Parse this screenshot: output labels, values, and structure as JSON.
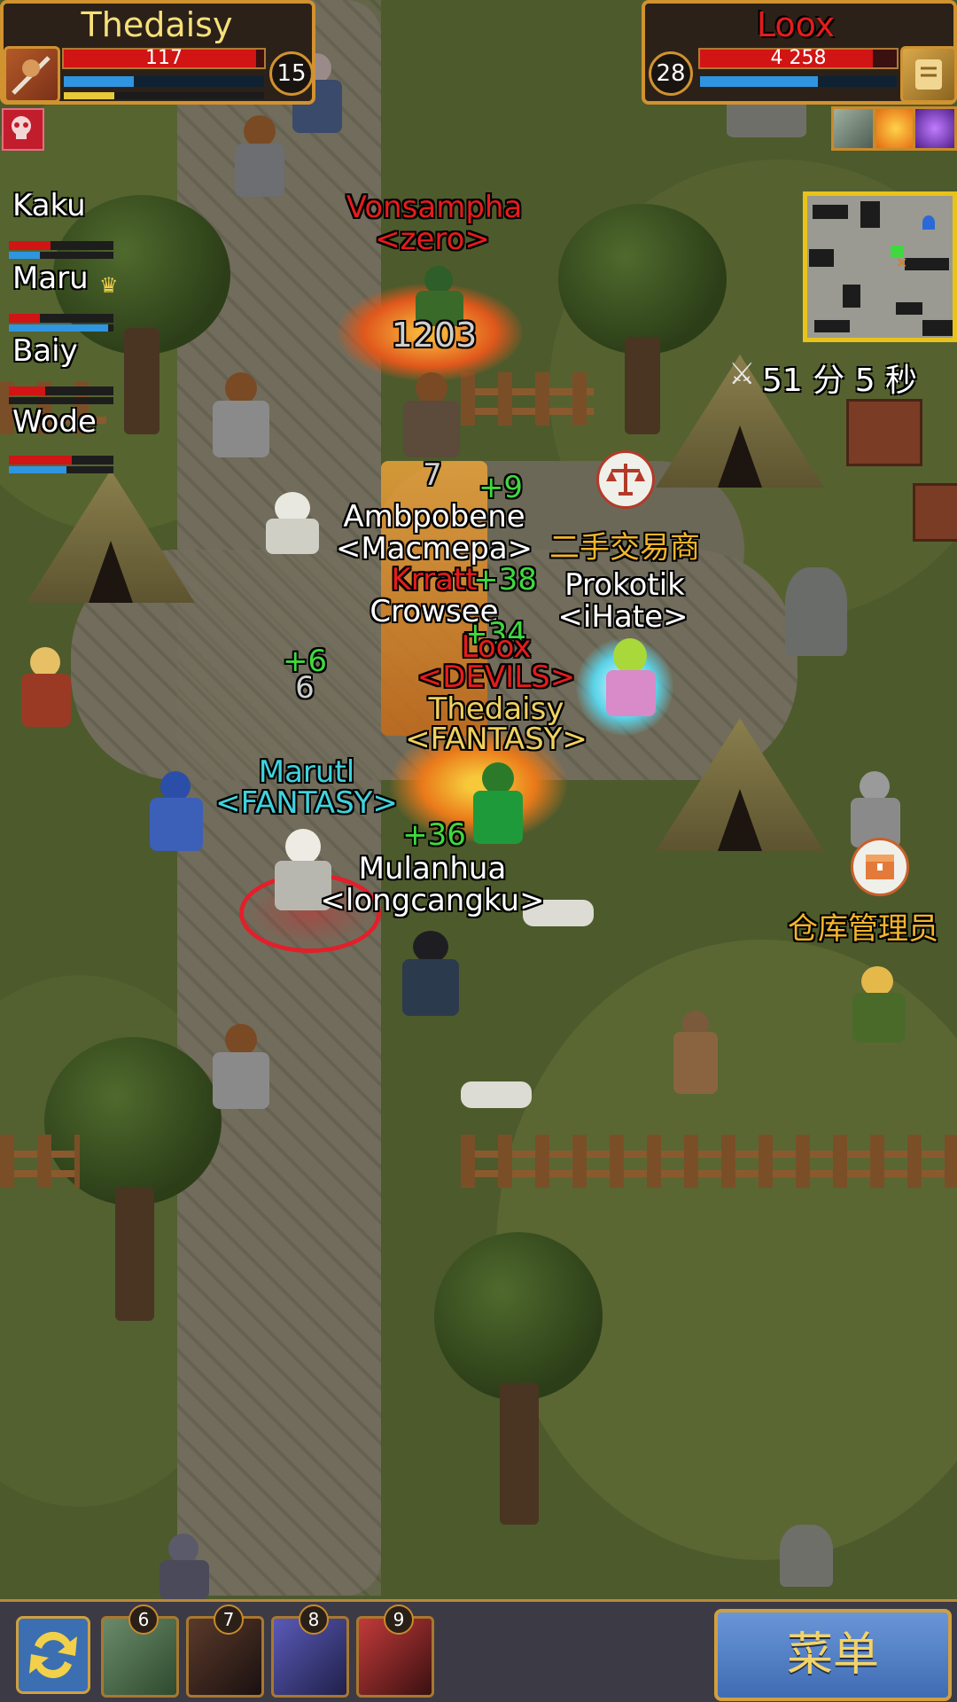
{
  "player": {
    "name": "Thedaisy",
    "hp": "117",
    "level": "15",
    "hp_fraction": 0.96,
    "mp_fraction": 0.35,
    "xp_fraction": 0.25
  },
  "target": {
    "name": "Loox",
    "hp": "4 258",
    "level": "28",
    "hp_fraction": 0.88,
    "mp_fraction": 0.6
  },
  "party": [
    {
      "name": "Kaku",
      "hp_fraction": 0.4,
      "mp_fraction": 0.3
    },
    {
      "name": "Maru",
      "hp_fraction": 0.3,
      "mp_fraction": 0.95
    },
    {
      "name": "Baiy",
      "hp_fraction": 0.35,
      "mp_fraction": 0.0
    },
    {
      "name": "Wode",
      "hp_fraction": 0.6,
      "mp_fraction": 0.55
    }
  ],
  "timer": "51 分 5 秒",
  "world_labels": {
    "vonsampha_name": "Vonsampha",
    "vonsampha_guild": "<zero>",
    "damage_1203": "1203",
    "damage_7": "7",
    "heal_9": "+9",
    "ambpobene_name": "Ambpobene",
    "ambpobene_guild": "<Macmepa>",
    "kiratt_name": "Krratt",
    "heal_38": "+38",
    "crowsee_name": "Crowsee",
    "trader_title": "二手交易商",
    "prokotik_name": "Prokotik",
    "prokotik_guild": "<iHate>",
    "heal_34": "+34",
    "loox_name": "Loox",
    "loox_guild": "<DEVILS>",
    "heal_6": "+6",
    "damage_6": "6",
    "thedaisy_name": "Thedaisy",
    "thedaisy_guild": "<FANTASY>",
    "marutl_name": "Marutl",
    "marutl_guild": "<FANTASY>",
    "heal_36": "+36",
    "mulanhua_name": "Mulanhua",
    "mulanhua_guild": "<longcangku>",
    "warehouse_title": "仓库管理员"
  },
  "hotbar": {
    "slots": [
      "6",
      "7",
      "8",
      "9"
    ],
    "menu_label": "菜单"
  },
  "icons": {
    "player_class": "warrior-portrait-icon",
    "target_class": "scroll-icon",
    "debuff": "red-skull-icon",
    "buffs": [
      "stone-buff-icon",
      "fire-swirl-buff-icon",
      "purple-star-buff-icon"
    ],
    "trader_bubble": "scales-icon",
    "warehouse_bubble": "chest-icon",
    "swap": "swap-arrows-icon",
    "timer": "sword-icon"
  },
  "colors": {
    "hud_border": "#d19230",
    "hp": "#d11414",
    "mp": "#2f95e0",
    "xp": "#e8c93a",
    "enemy_name": "#e51c1c",
    "ally_name": "#3fd3dd",
    "heal": "#3fd93f",
    "npc_title": "#f3b52b"
  }
}
